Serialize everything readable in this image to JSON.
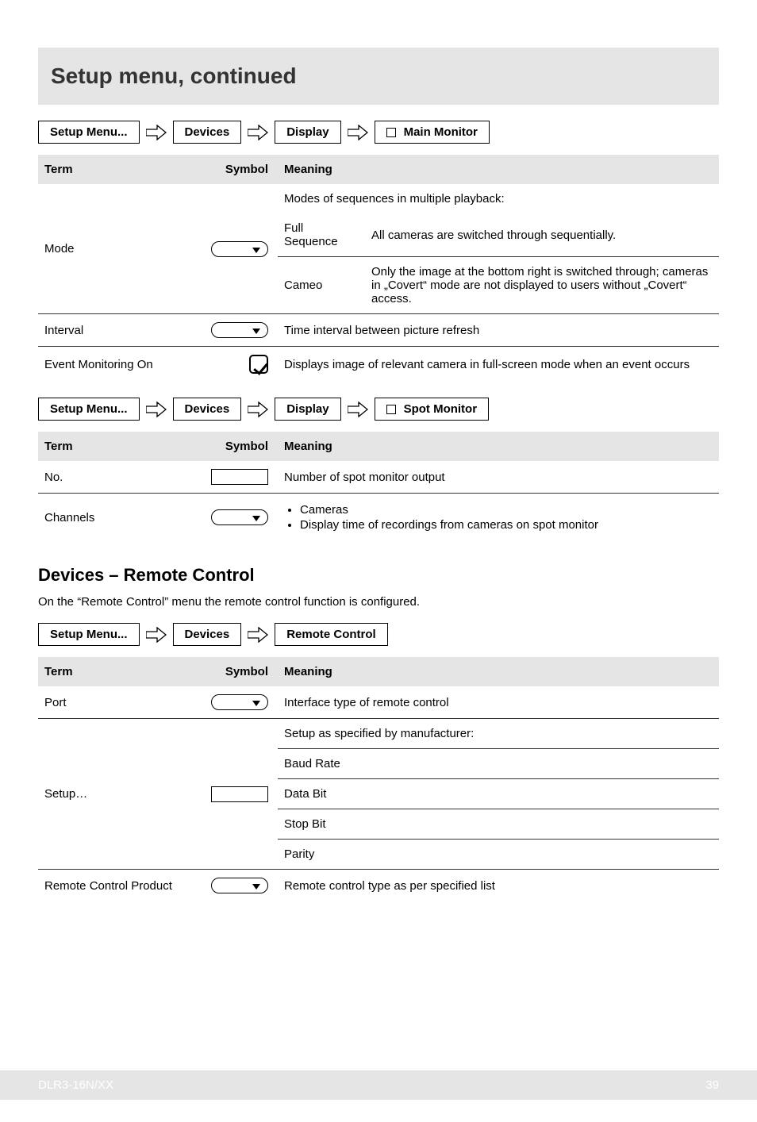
{
  "page_title": "Setup menu, continued",
  "breadcrumb1": {
    "a": "Setup Menu...",
    "b": "Devices",
    "c": "Display",
    "d": "Main Monitor"
  },
  "table1": {
    "headers": {
      "term": "Term",
      "symbol": "Symbol",
      "meaning": "Meaning"
    },
    "rows": {
      "mode": {
        "term": "Mode",
        "intro": "Modes of sequences in multiple playback:",
        "full_label": "Full Sequence",
        "full_meaning": "All cameras are switched through sequentially.",
        "cameo_label": "Cameo",
        "cameo_meaning": "Only the image at the bottom right is switched through; cameras in „Covert“ mode are not displayed to users without „Covert“ access."
      },
      "interval": {
        "term": "Interval",
        "meaning": "Time interval between picture refresh"
      },
      "event": {
        "term": "Event Monitoring On",
        "meaning": "Displays image of relevant camera in full-screen mode when an event occurs"
      }
    }
  },
  "breadcrumb2": {
    "a": "Setup Menu...",
    "b": "Devices",
    "c": "Display",
    "d": "Spot Monitor"
  },
  "table2": {
    "headers": {
      "term": "Term",
      "symbol": "Symbol",
      "meaning": "Meaning"
    },
    "rows": {
      "no": {
        "term": "No.",
        "meaning": "Number of spot monitor output"
      },
      "channels": {
        "term": "Channels",
        "b1": "Cameras",
        "b2": "Display time of recordings from cameras on spot monitor"
      }
    }
  },
  "section3": {
    "heading": "Devices – Remote Control",
    "desc": "On the “Remote Control” menu the remote control function is configured."
  },
  "breadcrumb3": {
    "a": "Setup Menu...",
    "b": "Devices",
    "c": "Remote Control"
  },
  "table3": {
    "headers": {
      "term": "Term",
      "symbol": "Symbol",
      "meaning": "Meaning"
    },
    "rows": {
      "port": {
        "term": "Port",
        "meaning": "Interface type of remote control"
      },
      "setup": {
        "term": "Setup…",
        "intro": "Setup as specified by manufacturer:",
        "r1": "Baud Rate",
        "r2": "Data Bit",
        "r3": "Stop Bit",
        "r4": "Parity"
      },
      "rcp": {
        "term": "Remote Control Product",
        "meaning": "Remote control type as per specified list"
      }
    }
  },
  "footer": {
    "model": "DLR3-16N/XX",
    "page": "39"
  }
}
